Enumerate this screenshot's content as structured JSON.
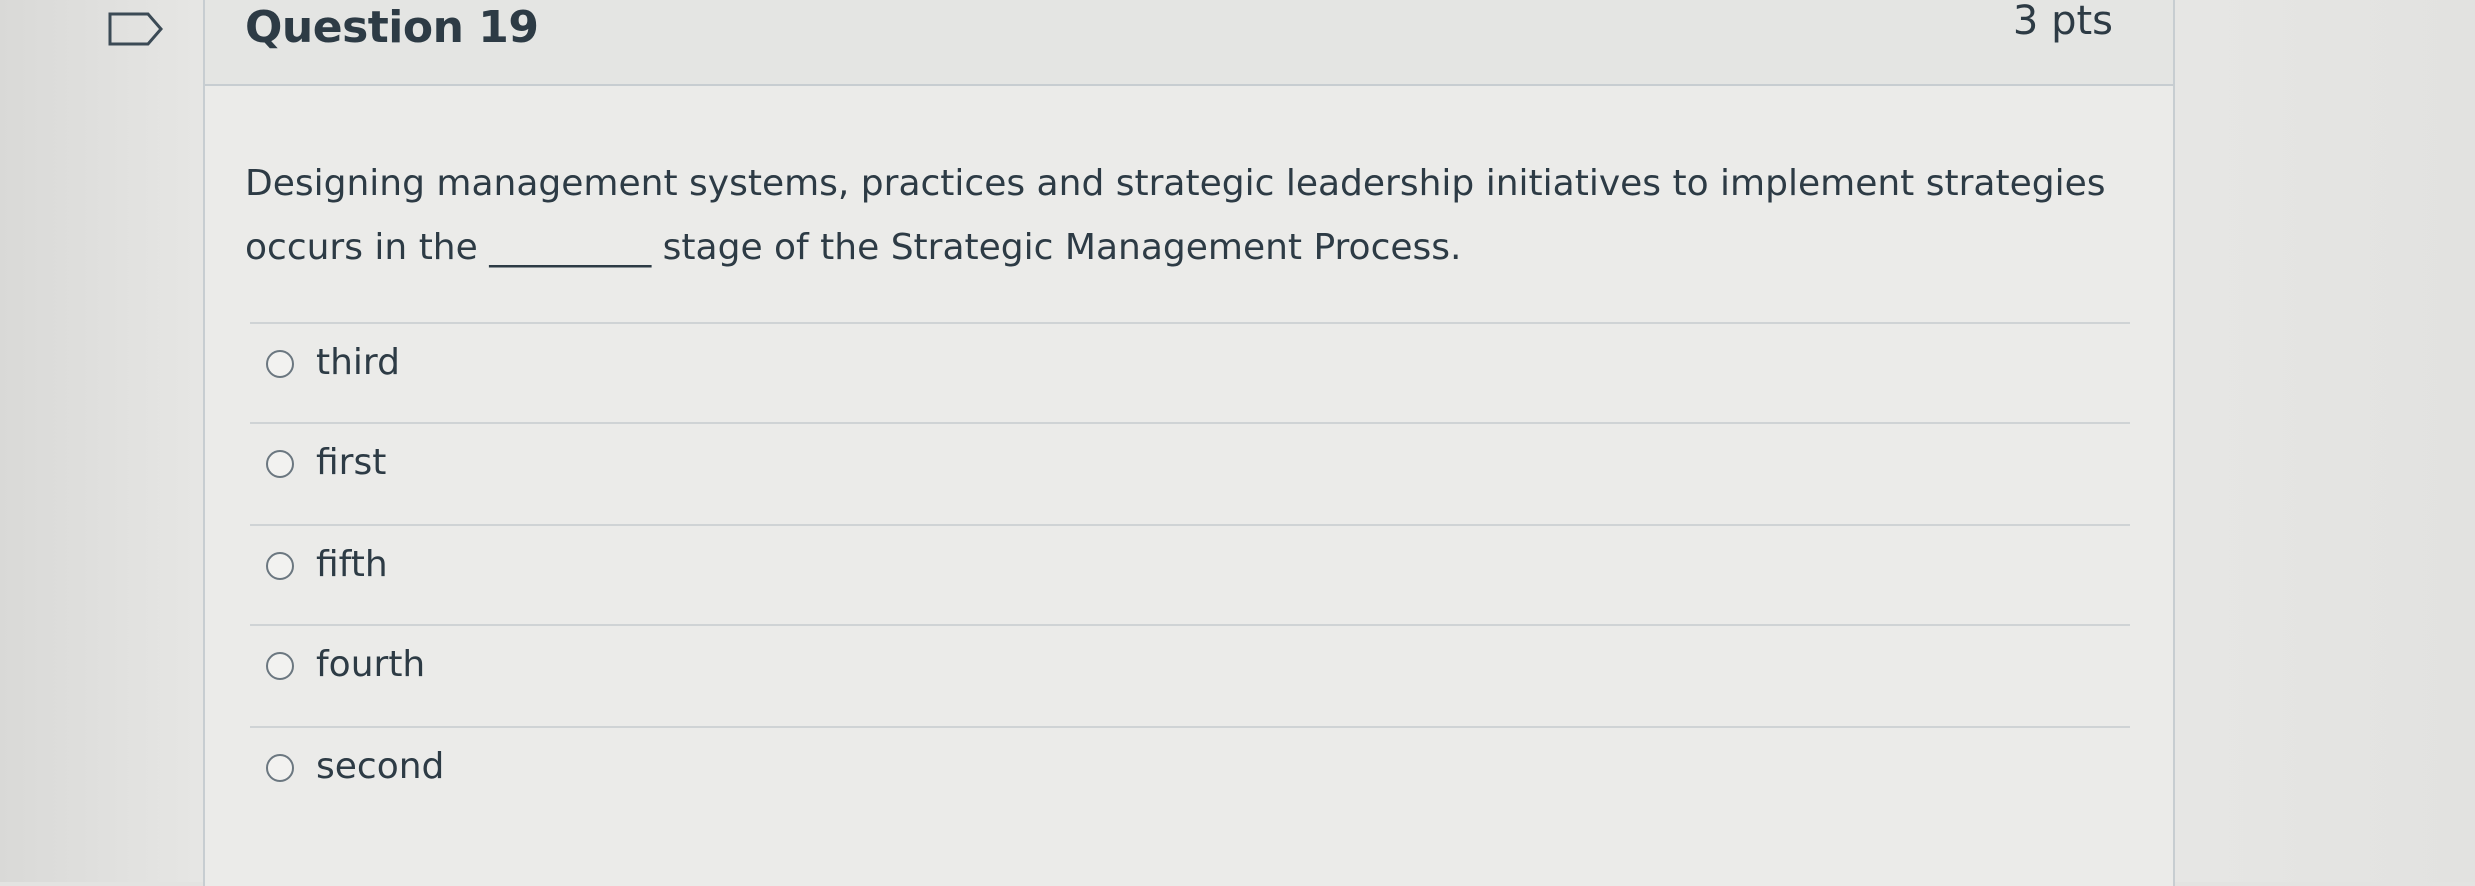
{
  "question": {
    "title": "Question 19",
    "points": "3 pts",
    "text_line1": "Designing management systems, practices and strategic leadership initiatives to implement strategies",
    "text_line2": "occurs in the _________ stage of the Strategic Management Process."
  },
  "answers": [
    {
      "label": "third",
      "selected": false
    },
    {
      "label": "first",
      "selected": false
    },
    {
      "label": "fifth",
      "selected": false
    },
    {
      "label": "fourth",
      "selected": false
    },
    {
      "label": "second",
      "selected": false
    }
  ],
  "icons": {
    "flag": "flag-bookmark-icon",
    "radio": "radio-empty-icon"
  },
  "colors": {
    "text": "#2d3b45",
    "border": "#c7cdd1",
    "header_bg": "#e4e5e3"
  }
}
